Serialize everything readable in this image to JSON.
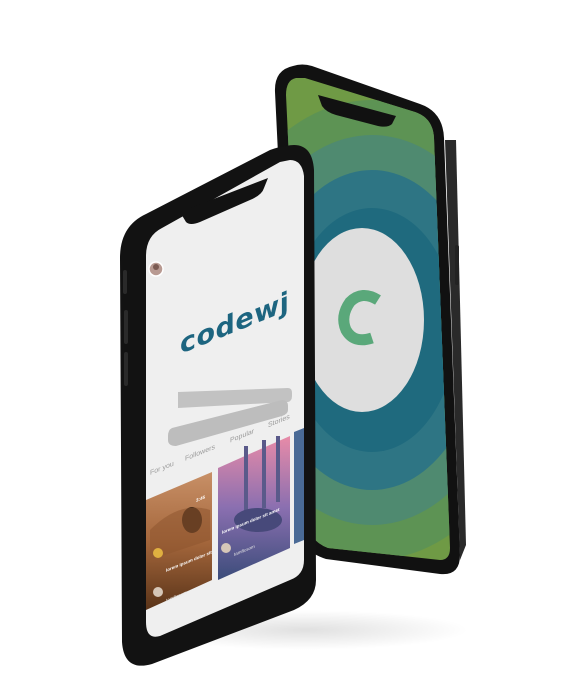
{
  "front_screen": {
    "brand": "codewj",
    "tabs": [
      {
        "label": "For you"
      },
      {
        "label": "Followers"
      },
      {
        "label": "Popular"
      },
      {
        "label": "Stories"
      }
    ],
    "cards": [
      {
        "badge": "3:45",
        "title": "lorem ipsum dolor sit",
        "author": "tamftcsom"
      },
      {
        "title": "lorem ipsum dolor sit amet",
        "author": "tamftcsom"
      }
    ]
  },
  "back_screen": {
    "logo_letter": "C",
    "ring_colors": [
      "#6f9a45",
      "#4f8a70",
      "#2e7584",
      "#1f6a7e",
      "#175e72"
    ],
    "logo_color": "#5aa87a"
  },
  "colors": {
    "brand": "#1d6580",
    "phone_body": "#141414",
    "front_screen_bg": "#efefef"
  }
}
